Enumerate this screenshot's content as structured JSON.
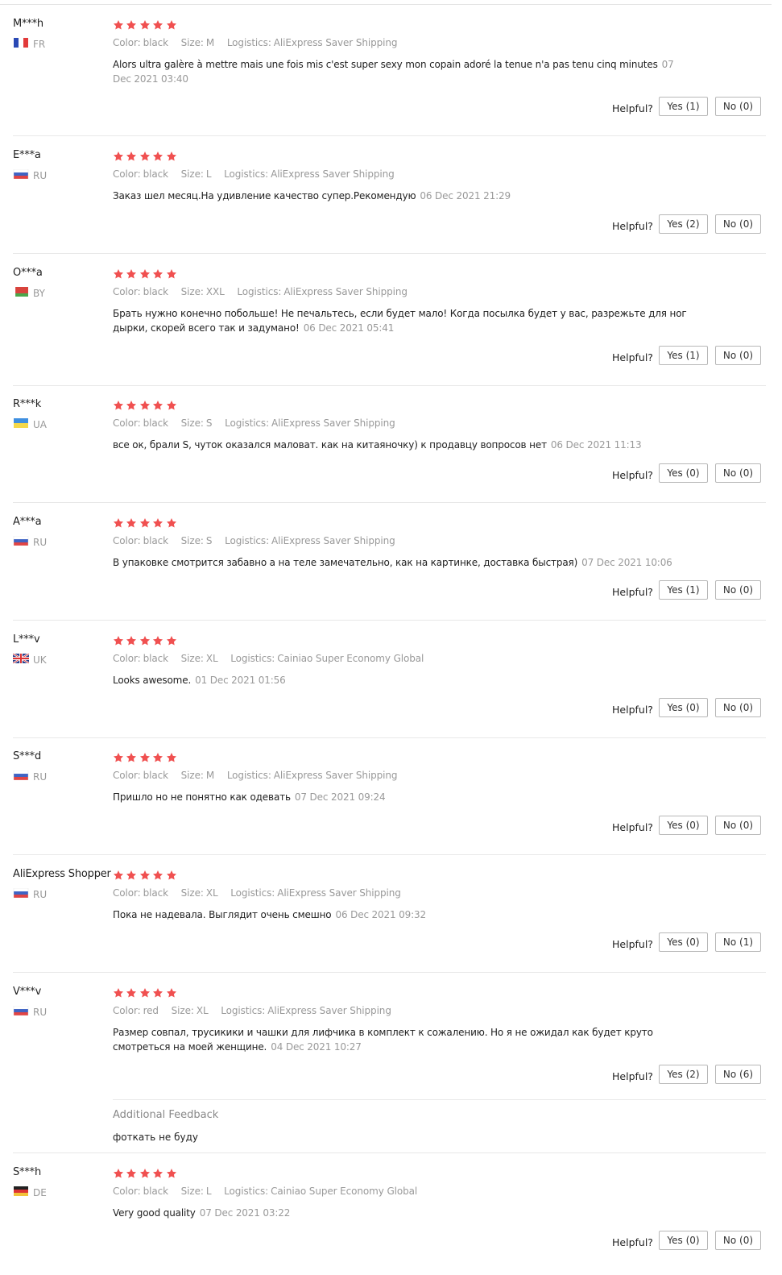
{
  "labels": {
    "color": "Color:",
    "size": "Size:",
    "logistics": "Logistics:",
    "helpful": "Helpful?"
  },
  "colors": {
    "star": "#f05050"
  },
  "reviews": [
    {
      "user": "M***h",
      "country": "FR",
      "rating": 5,
      "color": "black",
      "size": "M",
      "logistics": "AliExpress Saver Shipping",
      "text": "Alors ultra galère à mettre mais une fois mis c'est super sexy mon copain adoré la tenue n'a pas tenu cinq minutes",
      "date": "07 Dec 2021 03:40",
      "yes": "Yes (1)",
      "no": "No (0)"
    },
    {
      "user": "E***a",
      "country": "RU",
      "rating": 5,
      "color": "black",
      "size": "L",
      "logistics": "AliExpress Saver Shipping",
      "text": "Заказ шел месяц.На удивление качество супер.Рекомендую",
      "date": "06 Dec 2021 21:29",
      "yes": "Yes (2)",
      "no": "No (0)"
    },
    {
      "user": "O***a",
      "country": "BY",
      "rating": 5,
      "color": "black",
      "size": "XXL",
      "logistics": "AliExpress Saver Shipping",
      "text": "Брать нужно конечно побольше! Не печальтесь, если будет мало! Когда посылка будет у вас, разрежьте для ног дырки, скорей всего так и задумано!",
      "date": "06 Dec 2021 05:41",
      "yes": "Yes (1)",
      "no": "No (0)"
    },
    {
      "user": "R***k",
      "country": "UA",
      "rating": 5,
      "color": "black",
      "size": "S",
      "logistics": "AliExpress Saver Shipping",
      "text": "все ок, брали S, чуток оказался маловат. как на китаяночку) к продавцу вопросов нет",
      "date": "06 Dec 2021 11:13",
      "yes": "Yes (0)",
      "no": "No (0)"
    },
    {
      "user": "A***a",
      "country": "RU",
      "rating": 5,
      "color": "black",
      "size": "S",
      "logistics": "AliExpress Saver Shipping",
      "text": "В упаковке смотрится забавно а на теле замечательно, как на картинке, доставка быстрая)",
      "date": "07 Dec 2021 10:06",
      "yes": "Yes (1)",
      "no": "No (0)"
    },
    {
      "user": "L***v",
      "country": "UK",
      "rating": 5,
      "color": "black",
      "size": "XL",
      "logistics": "Cainiao Super Economy Global",
      "text": "Looks awesome.",
      "date": "01 Dec 2021 01:56",
      "yes": "Yes (0)",
      "no": "No (0)"
    },
    {
      "user": "S***d",
      "country": "RU",
      "rating": 5,
      "color": "black",
      "size": "M",
      "logistics": "AliExpress Saver Shipping",
      "text": "Пришло но не понятно как одевать",
      "date": "07 Dec 2021 09:24",
      "yes": "Yes (0)",
      "no": "No (0)"
    },
    {
      "user": "AliExpress Shopper",
      "country": "RU",
      "rating": 5,
      "color": "black",
      "size": "XL",
      "logistics": "AliExpress Saver Shipping",
      "text": "Пока не надевала. Выглядит очень смешно",
      "date": "06 Dec 2021 09:32",
      "yes": "Yes (0)",
      "no": "No (1)"
    },
    {
      "user": "V***v",
      "country": "RU",
      "rating": 5,
      "color": "red",
      "size": "XL",
      "logistics": "AliExpress Saver Shipping",
      "text": "Размер совпал, трусикики и чашки для лифчика в комплект к сожалению. Но я не ожидал как будет круто смотреться на моей женщине.",
      "date": "04 Dec 2021 10:27",
      "yes": "Yes (2)",
      "no": "No (6)",
      "additional_title": "Additional Feedback",
      "additional_text": "фоткать не буду"
    },
    {
      "user": "S***h",
      "country": "DE",
      "rating": 5,
      "color": "black",
      "size": "L",
      "logistics": "Cainiao Super Economy Global",
      "text": "Very good quality",
      "date": "07 Dec 2021 03:22",
      "yes": "Yes (0)",
      "no": "No (0)"
    }
  ]
}
